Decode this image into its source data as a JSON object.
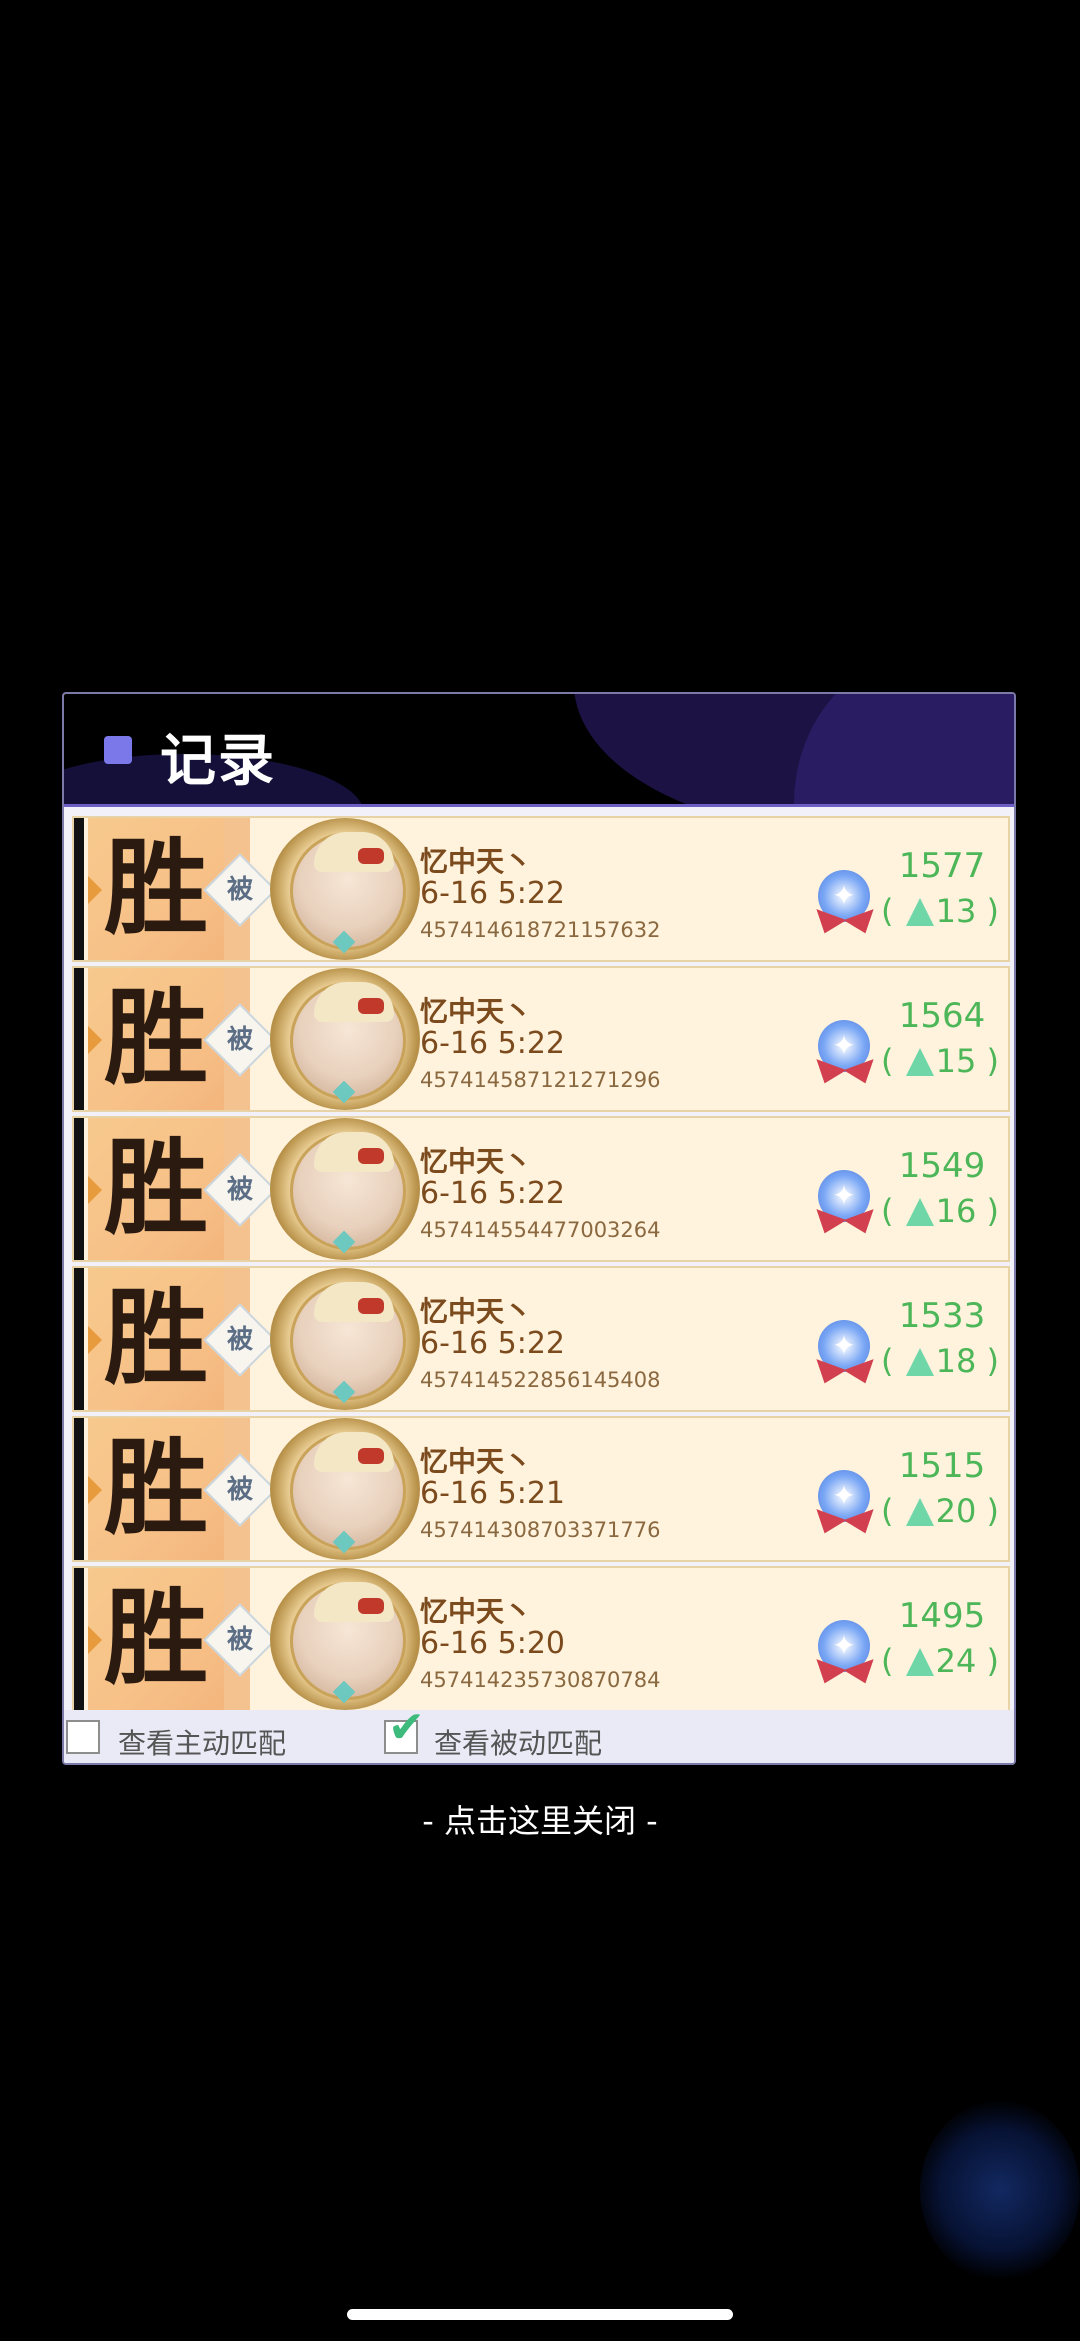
{
  "dialog": {
    "title": "记录",
    "records": [
      {
        "result": "胜",
        "mode": "被",
        "name": "忆中天丶",
        "time": "6-16 5:22",
        "id": "457414618721157632",
        "score": "1577",
        "delta": "13"
      },
      {
        "result": "胜",
        "mode": "被",
        "name": "忆中天丶",
        "time": "6-16 5:22",
        "id": "457414587121271296",
        "score": "1564",
        "delta": "15"
      },
      {
        "result": "胜",
        "mode": "被",
        "name": "忆中天丶",
        "time": "6-16 5:22",
        "id": "457414554477003264",
        "score": "1549",
        "delta": "16"
      },
      {
        "result": "胜",
        "mode": "被",
        "name": "忆中天丶",
        "time": "6-16 5:22",
        "id": "457414522856145408",
        "score": "1533",
        "delta": "18"
      },
      {
        "result": "胜",
        "mode": "被",
        "name": "忆中天丶",
        "time": "6-16 5:21",
        "id": "457414308703371776",
        "score": "1515",
        "delta": "20"
      },
      {
        "result": "胜",
        "mode": "被",
        "name": "忆中天丶",
        "time": "6-16 5:20",
        "id": "457414235730870784",
        "score": "1495",
        "delta": "24"
      }
    ],
    "filters": {
      "active_label": "查看主动匹配",
      "active_checked": false,
      "passive_label": "查看被动匹配",
      "passive_checked": true
    }
  },
  "close_hint": "- 点击这里关闭 -",
  "colors": {
    "background": "#000000",
    "accent": "#7b78ea",
    "score_green": "#4cb658",
    "row_bg": "#fff3dd"
  }
}
